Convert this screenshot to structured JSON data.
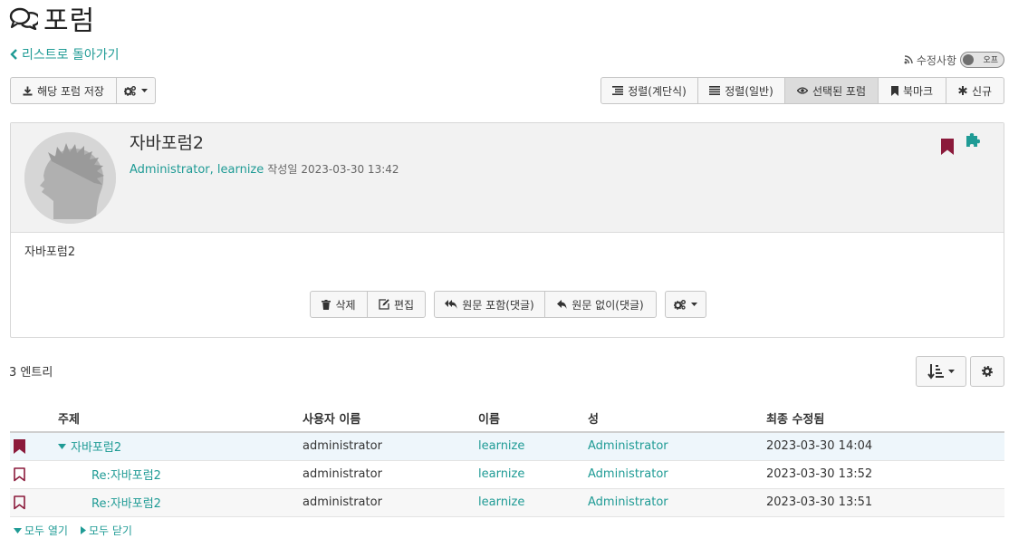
{
  "page": {
    "title": "포럼",
    "title_icon": "comments-icon"
  },
  "back_link": {
    "label": "리스트로 돌아가기",
    "icon": "chevron-left-icon"
  },
  "subscription": {
    "label": "수정사항",
    "icon": "rss-icon",
    "toggle_label": "오프",
    "state": "off"
  },
  "toolbar_left": {
    "save_label": "해당 포럼 저장",
    "save_icon": "download-icon",
    "tools_icon": "cogs-icon"
  },
  "view_modes": [
    {
      "label": "정렬(계단식)",
      "icon": "indent-lines-icon",
      "active": false
    },
    {
      "label": "정렬(일반)",
      "icon": "list-lines-icon",
      "active": false
    },
    {
      "label": "선택된 포럼",
      "icon": "eye-icon",
      "active": true
    },
    {
      "label": "북마크",
      "icon": "bookmark-icon",
      "active": false
    },
    {
      "label": "신규",
      "icon": "asterisk-icon",
      "active": false
    }
  ],
  "message": {
    "title": "자바포럼2",
    "author": "Administrator, learnize",
    "created_label": "작성일",
    "created_at": "2023-03-30 13:42",
    "body": "자바포럼2",
    "bookmarked": true,
    "actions": {
      "delete_label": "삭제",
      "edit_label": "편집",
      "reply_quote_label": "원문 포함(댓글)",
      "reply_label": "원문 없이(댓글)"
    }
  },
  "entries": {
    "count_label": "3 엔트리"
  },
  "table": {
    "columns": [
      "주제",
      "사용자 이름",
      "이름",
      "성",
      "최종 수정됨"
    ],
    "rows": [
      {
        "subject": "자바포럼2",
        "username": "administrator",
        "first_name": "learnize",
        "last_name": "Administrator",
        "modified": "2023-03-30 14:04",
        "bookmarked": true,
        "selected": true
      },
      {
        "subject": "Re:자바포럼2",
        "username": "administrator",
        "first_name": "learnize",
        "last_name": "Administrator",
        "modified": "2023-03-30 13:52",
        "bookmarked": false,
        "selected": false
      },
      {
        "subject": "Re:자바포럼2",
        "username": "administrator",
        "first_name": "learnize",
        "last_name": "Administrator",
        "modified": "2023-03-30 13:51",
        "bookmarked": false,
        "selected": false
      }
    ]
  },
  "tree_controls": {
    "expand_all_label": "모두 열기",
    "collapse_all_label": "모두 닫기"
  },
  "colors": {
    "accent": "#1f9b95",
    "bookmark": "#8b1a3b",
    "selected_row": "#eef6fb"
  }
}
